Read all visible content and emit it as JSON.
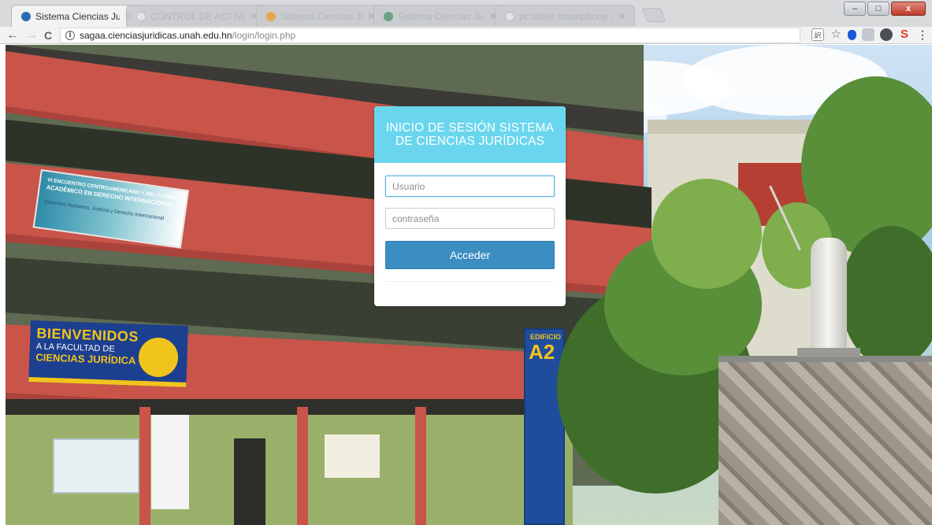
{
  "browser": {
    "tabs": [
      {
        "title": "Sistema Ciencias Jurídica",
        "active": true
      },
      {
        "title": "CONTROL DE ACTIVIDADES",
        "active": false
      },
      {
        "title": "Sistema Ciencias Jurídicas",
        "active": false
      },
      {
        "title": "Sistema Ciencias Jurídicas",
        "active": false
      },
      {
        "title": "pc tablet smartphone - Bu...",
        "active": false
      }
    ],
    "window_controls": {
      "minimize": "–",
      "maximize": "□",
      "close": "x"
    },
    "nav": {
      "back": "←",
      "forward": "→",
      "reload": "C"
    },
    "url": {
      "host": "sagaa.cienciasjuridicas.unah.edu.hn",
      "path": "/login/login.php"
    },
    "extensions": [
      "translate-icon",
      "star-icon",
      "shield-icon",
      "puzzle-icon",
      "ghost-icon",
      "s-icon",
      "menu-icon"
    ]
  },
  "login": {
    "title": "INICIO DE SESIÓN SISTEMA DE CIENCIAS JURÍDICAS",
    "username_placeholder": "Usuario",
    "password_placeholder": "contraseña",
    "submit_label": "Acceder",
    "header_color": "#6ad6ee",
    "button_color": "#3c8dc2"
  },
  "background": {
    "banner_top": [
      "VI ENCUENTRO CENTROAMERICANO Y DEL CARIBE",
      "ACADÉMICO EN DERECHO INTERNACIONAL",
      "Derechos Humanos, Justicia y Derecho Internacional"
    ],
    "banner_welcome": [
      "BIENVENIDOS",
      "A LA FACULTAD DE",
      "CIENCIAS JURÍDICAS"
    ],
    "building_sign": [
      "EDIFICIO",
      "A2"
    ]
  }
}
